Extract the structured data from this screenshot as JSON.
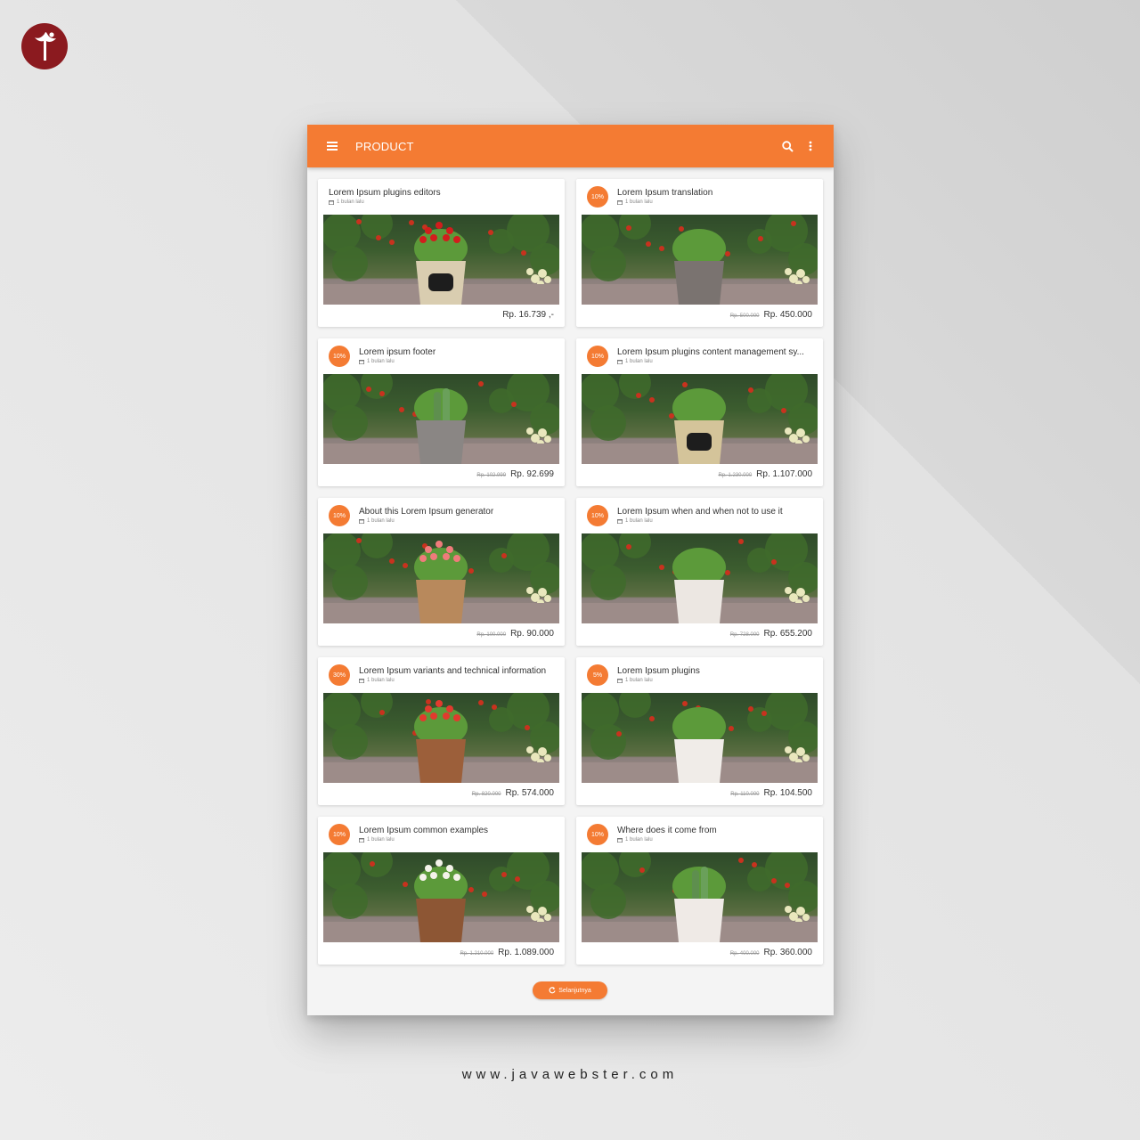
{
  "header": {
    "title": "PRODUCT"
  },
  "colors": {
    "accent": "#f47b33",
    "brand": "#8b1a1f"
  },
  "products": [
    {
      "title": "Lorem Ipsum plugins editors",
      "time": "1 bulan lalu",
      "discount": "",
      "old_price": "",
      "price": "Rp. 16.739 ,-",
      "plant": "red-pepper-pot"
    },
    {
      "title": "Lorem Ipsum translation",
      "time": "1 bulan lalu",
      "discount": "10%",
      "old_price": "Rp. 500.000",
      "price": "Rp. 450.000",
      "plant": "succulent-grey-pot"
    },
    {
      "title": "Lorem ipsum footer",
      "time": "1 bulan lalu",
      "discount": "10%",
      "old_price": "Rp. 102.999",
      "price": "Rp. 92.699",
      "plant": "cactus-grey-pot"
    },
    {
      "title": "Lorem Ipsum plugins content management sy...",
      "time": "1 bulan lalu",
      "discount": "10%",
      "old_price": "Rp. 1.230.000",
      "price": "Rp. 1.107.000",
      "plant": "moss-cream-pot"
    },
    {
      "title": "About this Lorem Ipsum generator",
      "time": "1 bulan lalu",
      "discount": "10%",
      "old_price": "Rp. 100.000",
      "price": "Rp. 90.000",
      "plant": "pink-flower-clay-pot"
    },
    {
      "title": "Lorem Ipsum when and when not to use it",
      "time": "1 bulan lalu",
      "discount": "10%",
      "old_price": "Rp. 728.000",
      "price": "Rp. 655.200",
      "plant": "jade-white-pot"
    },
    {
      "title": "Lorem Ipsum variants and technical information",
      "time": "1 bulan lalu",
      "discount": "30%",
      "old_price": "Rp. 820.000",
      "price": "Rp. 574.000",
      "plant": "red-kalanchoe"
    },
    {
      "title": "Lorem Ipsum plugins",
      "time": "1 bulan lalu",
      "discount": "5%",
      "old_price": "Rp. 110.000",
      "price": "Rp. 104.500",
      "plant": "jade-small-white-pot"
    },
    {
      "title": "Lorem Ipsum common examples",
      "time": "1 bulan lalu",
      "discount": "10%",
      "old_price": "Rp. 1.210.000",
      "price": "Rp. 1.089.000",
      "plant": "white-kalanchoe"
    },
    {
      "title": "Where does it come from",
      "time": "1 bulan lalu",
      "discount": "10%",
      "old_price": "Rp. 400.000",
      "price": "Rp. 360.000",
      "plant": "bunny-cactus-white-pot"
    }
  ],
  "load_more": "Selanjutnya",
  "footer": {
    "site": "www.javawebster.com"
  }
}
